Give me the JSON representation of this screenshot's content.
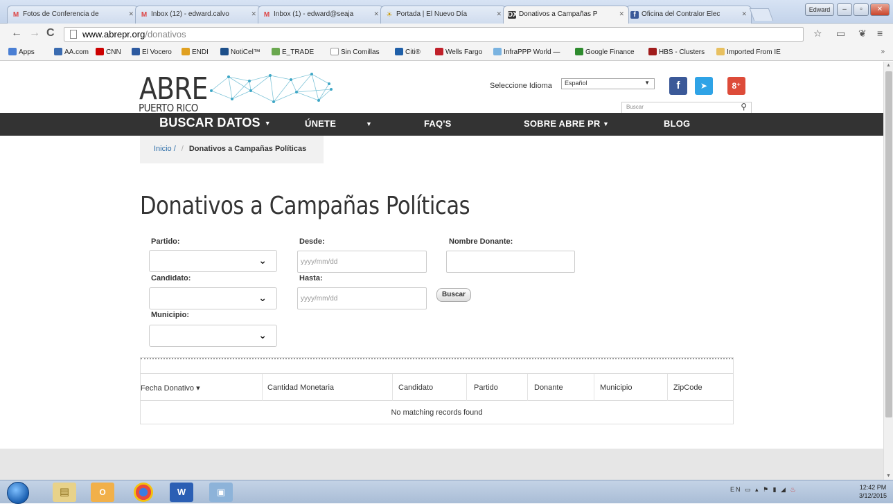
{
  "browser": {
    "tabs": [
      {
        "label": "Fotos de Conferencia de",
        "favicon": "M",
        "kind": "gmail"
      },
      {
        "label": "Inbox (12) - edward.calvo",
        "favicon": "M",
        "kind": "gmail"
      },
      {
        "label": "Inbox (1) - edward@seaja",
        "favicon": "M",
        "kind": "gmail"
      },
      {
        "label": "Portada | El Nuevo Día",
        "favicon": "☀",
        "kind": "endi"
      },
      {
        "label": "Donativos a Campañas P",
        "favicon": "DX",
        "kind": "abre"
      },
      {
        "label": "Oficina del Contralor Elec",
        "favicon": "f",
        "kind": "fb"
      }
    ],
    "window_label": "Edward",
    "url_domain": "www.abrepr.org",
    "url_path": "/donativos",
    "bookmarks": [
      {
        "label": "Apps",
        "color": "#4a7fd4"
      },
      {
        "label": "AA.com",
        "color": "#3a6bb0"
      },
      {
        "label": "CNN",
        "color": "#cc0000"
      },
      {
        "label": "El Vocero",
        "color": "#2d5aa0"
      },
      {
        "label": "ENDI",
        "color": "#e0a020"
      },
      {
        "label": "NotiCel™",
        "color": "#1d4f8a"
      },
      {
        "label": "E_TRADE",
        "color": "#6aa84f"
      },
      {
        "label": "Sin Comillas",
        "color": "#dddddd"
      },
      {
        "label": "Citi®",
        "color": "#1f5fa8"
      },
      {
        "label": "Wells Fargo",
        "color": "#c0202a"
      },
      {
        "label": "InfraPPP World —",
        "color": "#7ab3e0"
      },
      {
        "label": "Google Finance",
        "color": "#2e8b2e"
      },
      {
        "label": "HBS - Clusters",
        "color": "#a01c1c"
      },
      {
        "label": "Imported From IE",
        "color": "#e8c060"
      }
    ]
  },
  "site": {
    "logo": "ABRE",
    "logo_sub": "PUERTO RICO",
    "language_label": "Seleccione Idioma",
    "language_value": "Español",
    "search_placeholder": "Buscar",
    "social": [
      {
        "name": "facebook",
        "glyph": "f",
        "color": "#3b5998"
      },
      {
        "name": "twitter",
        "glyph": "➤",
        "color": "#2fa3e6"
      },
      {
        "name": "google-plus",
        "glyph": "8⁺",
        "color": "#dd4b39"
      }
    ],
    "nav": {
      "buscar": "BUSCAR DATOS",
      "unete": "ÚNETE",
      "faqs": "FAQ'S",
      "sobre": "SOBRE ABRE PR",
      "blog": "BLOG"
    },
    "breadcrumb": {
      "home": "Inicio /",
      "current": "Donativos a Campañas Políticas"
    }
  },
  "page": {
    "title": "Donativos a Campañas Políticas",
    "filters": {
      "partido_label": "Partido:",
      "candidato_label": "Candidato:",
      "municipio_label": "Municipio:",
      "desde_label": "Desde:",
      "hasta_label": "Hasta:",
      "donante_label": "Nombre Donante:",
      "date_placeholder": "yyyy/mm/dd",
      "search_button": "Buscar"
    },
    "table": {
      "columns": [
        "Fecha Donativo",
        "Cantidad Monetaria",
        "Candidato",
        "Partido",
        "Donante",
        "Municipio",
        "ZipCode"
      ],
      "sort_indicator": "▾",
      "empty_message": "No matching records found"
    }
  },
  "taskbar": {
    "language": "EN",
    "time": "12:42 PM",
    "date": "3/12/2015"
  }
}
